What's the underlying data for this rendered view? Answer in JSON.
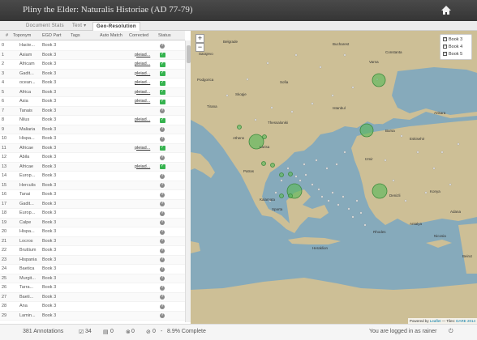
{
  "header": {
    "title": "Pliny the Elder: Naturalis Historiae (AD 77-79)"
  },
  "tabs": [
    {
      "label": "Document Stats"
    },
    {
      "label": "Text ▾"
    },
    {
      "label": "Geo-Resolution"
    }
  ],
  "table": {
    "columns": [
      "#",
      "Toponym",
      "EGD Part",
      "Tags",
      "Auto Match",
      "Corrected",
      "Status"
    ],
    "rows": [
      {
        "id": "0",
        "toponym": "Hacte...",
        "part": "Book 3",
        "corrected": "",
        "status": "unchecked"
      },
      {
        "id": "1",
        "toponym": "Asiam",
        "part": "Book 3",
        "corrected": "pleiad...",
        "status": "verified"
      },
      {
        "id": "2",
        "toponym": "Africam",
        "part": "Book 3",
        "corrected": "pleiad...",
        "status": "verified"
      },
      {
        "id": "3",
        "toponym": "Gadit...",
        "part": "Book 3",
        "corrected": "pleiad...",
        "status": "verified"
      },
      {
        "id": "4",
        "toponym": "ocean...",
        "part": "Book 3",
        "corrected": "pleiad...",
        "status": "verified"
      },
      {
        "id": "5",
        "toponym": "Africa",
        "part": "Book 3",
        "corrected": "pleiad...",
        "status": "verified"
      },
      {
        "id": "6",
        "toponym": "Asia",
        "part": "Book 3",
        "corrected": "pleiad...",
        "status": "verified"
      },
      {
        "id": "7",
        "toponym": "Tanais",
        "part": "Book 3",
        "corrected": "",
        "status": "unchecked"
      },
      {
        "id": "8",
        "toponym": "Nilus",
        "part": "Book 3",
        "corrected": "pleiad...",
        "status": "verified"
      },
      {
        "id": "9",
        "toponym": "Maliaria",
        "part": "Book 3",
        "corrected": "",
        "status": "unchecked"
      },
      {
        "id": "10",
        "toponym": "Hispa...",
        "part": "Book 3",
        "corrected": "",
        "status": "unchecked"
      },
      {
        "id": "11",
        "toponym": "Africae",
        "part": "Book 3",
        "corrected": "pleiad...",
        "status": "verified"
      },
      {
        "id": "12",
        "toponym": "Abila",
        "part": "Book 3",
        "corrected": "",
        "status": "unchecked"
      },
      {
        "id": "13",
        "toponym": "Africae",
        "part": "Book 3",
        "corrected": "pleiad...",
        "status": "verified"
      },
      {
        "id": "14",
        "toponym": "Europ...",
        "part": "Book 3",
        "corrected": "",
        "status": "unchecked"
      },
      {
        "id": "15",
        "toponym": "Herculis",
        "part": "Book 3",
        "corrected": "",
        "status": "unchecked"
      },
      {
        "id": "16",
        "toponym": "Tanai",
        "part": "Book 3",
        "corrected": "",
        "status": "unchecked"
      },
      {
        "id": "17",
        "toponym": "Gadit...",
        "part": "Book 3",
        "corrected": "",
        "status": "unchecked"
      },
      {
        "id": "18",
        "toponym": "Europ...",
        "part": "Book 3",
        "corrected": "",
        "status": "unchecked"
      },
      {
        "id": "19",
        "toponym": "Calpe",
        "part": "Book 3",
        "corrected": "",
        "status": "unchecked"
      },
      {
        "id": "20",
        "toponym": "Hispa...",
        "part": "Book 3",
        "corrected": "",
        "status": "unchecked"
      },
      {
        "id": "21",
        "toponym": "Locros",
        "part": "Book 3",
        "corrected": "",
        "status": "unchecked"
      },
      {
        "id": "22",
        "toponym": "Bruttium",
        "part": "Book 3",
        "corrected": "",
        "status": "unchecked"
      },
      {
        "id": "23",
        "toponym": "Hispania",
        "part": "Book 3",
        "corrected": "",
        "status": "unchecked"
      },
      {
        "id": "24",
        "toponym": "Baetica",
        "part": "Book 3",
        "corrected": "",
        "status": "unchecked"
      },
      {
        "id": "25",
        "toponym": "Murgit...",
        "part": "Book 3",
        "corrected": "",
        "status": "unchecked"
      },
      {
        "id": "26",
        "toponym": "Tarra...",
        "part": "Book 3",
        "corrected": "",
        "status": "unchecked"
      },
      {
        "id": "27",
        "toponym": "Baeti...",
        "part": "Book 3",
        "corrected": "",
        "status": "unchecked"
      },
      {
        "id": "28",
        "toponym": "Ana",
        "part": "Book 3",
        "corrected": "",
        "status": "unchecked"
      },
      {
        "id": "29",
        "toponym": "Lamin...",
        "part": "Book 3",
        "corrected": "",
        "status": "unchecked"
      }
    ]
  },
  "map": {
    "zoom_in": "+",
    "zoom_out": "−",
    "legend": [
      "Book 3",
      "Book 4",
      "Book 5"
    ],
    "labels": [
      "Sofia",
      "Athens",
      "Ankara",
      "Istanbul",
      "Antalya",
      "Beirut",
      "Nicosia",
      "Izmir",
      "Thessaloniki",
      "Bursa",
      "Konya",
      "Sarajevo",
      "Belgrade",
      "Bucharest",
      "Skopje",
      "Tirana",
      "Podgorica",
      "Varna",
      "Constanta",
      "Eskisehir",
      "Adana",
      "Denizli",
      "Heraklion",
      "Sparta",
      "Patras",
      "Larisa",
      "Kalamata",
      "Rhodes"
    ],
    "attribution_prefix": "Powered by",
    "attribution_leaflet": "Leaflet",
    "attribution_mid": "— Tiles:",
    "attribution_tiles": "DARE 2014"
  },
  "footer": {
    "annotations": "381 Annotations",
    "verified_count": "34",
    "not_identifiable": "0",
    "false_detection": "0",
    "ignore": "0",
    "complete": "8.9% Complete",
    "login_text": "You are logged in as rainer"
  },
  "colors": {
    "verified": "#36b34f",
    "marker": "#5cb85c",
    "sea": "#7fa6b6",
    "land": "#cdbf96"
  }
}
